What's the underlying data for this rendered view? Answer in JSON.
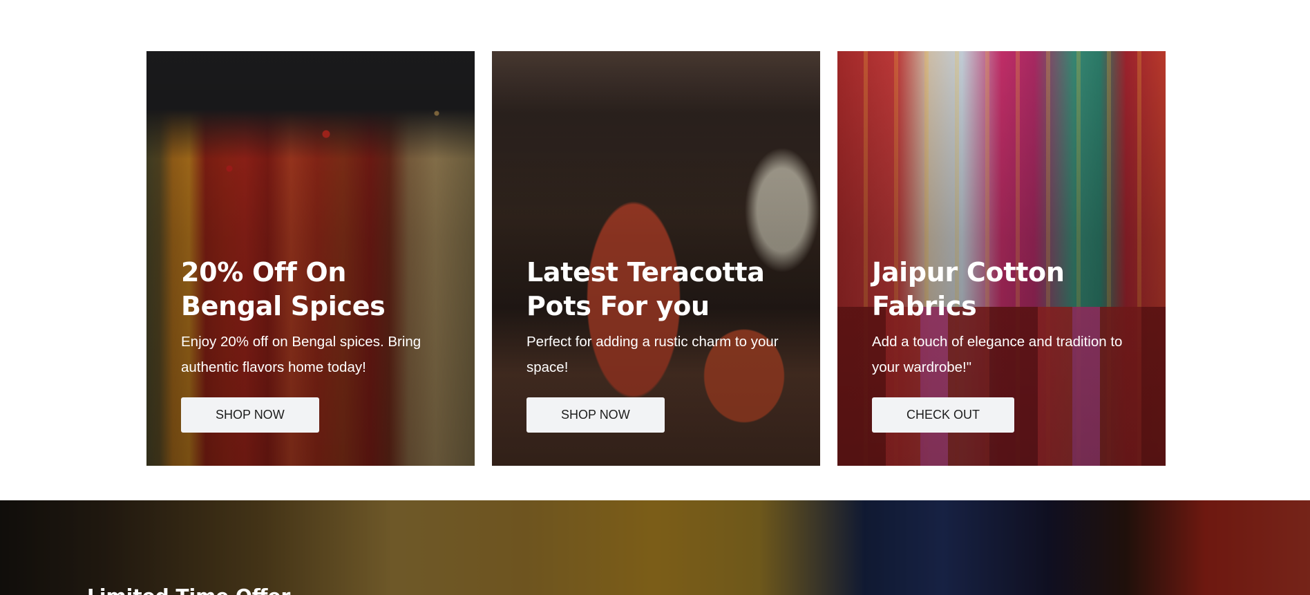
{
  "promo_cards": [
    {
      "title": "20% Off On Bengal Spices",
      "description": "Enjoy 20% off on Bengal spices. Bring authentic flavors home today!",
      "button_label": "SHOP NOW",
      "image": "bengal-spices-image"
    },
    {
      "title": "Latest Teracotta Pots For you",
      "description": "Perfect for adding a rustic charm to your space!",
      "button_label": "SHOP NOW",
      "image": "terracotta-pots-image"
    },
    {
      "title": "Jaipur Cotton Fabrics",
      "description": "Add a touch of elegance and tradition to your wardrobe!\"",
      "button_label": "CHECK OUT",
      "image": "jaipur-fabrics-image"
    }
  ],
  "banner": {
    "heading": "Limited Time Offer",
    "image": "handicraft-pots-banner-image"
  }
}
